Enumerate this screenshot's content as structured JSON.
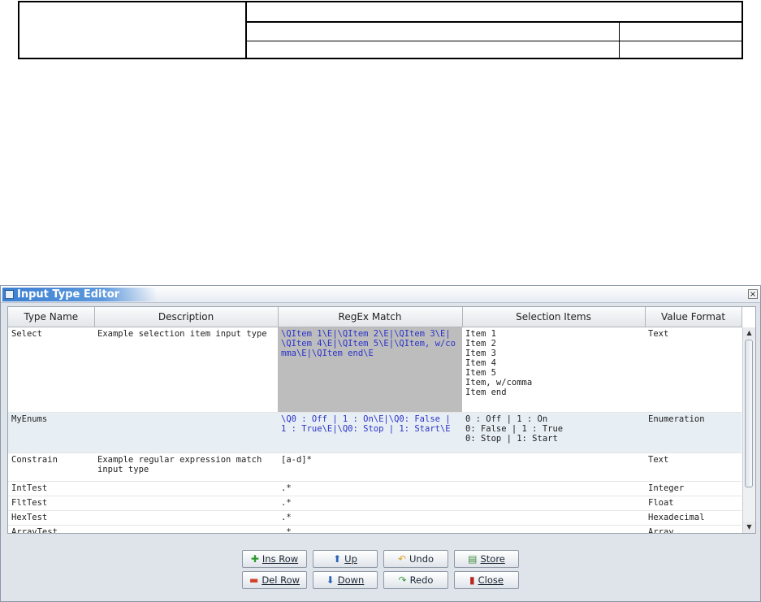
{
  "window": {
    "title": "Input Type Editor",
    "close_glyph": "×"
  },
  "table": {
    "columns": [
      "Type Name",
      "Description",
      "RegEx Match",
      "Selection Items",
      "Value Format"
    ],
    "rows": [
      {
        "name": "Select",
        "description": "Example selection item input type",
        "regex": "\\QItem 1\\E|\\QItem 2\\E|\\QItem 3\\E|\\QItem 4\\E|\\QItem 5\\E|\\QItem, w/comma\\E|\\QItem end\\E",
        "items": "Item 1\nItem 2\nItem 3\nItem 4\nItem 5\nItem, w/comma\nItem end",
        "format": "Text"
      },
      {
        "name": "MyEnums",
        "description": "",
        "regex": "\\Q0 : Off | 1 : On\\E|\\Q0: False | 1 : True\\E|\\Q0: Stop | 1: Start\\E",
        "items": "0 : Off | 1 : On\n0: False | 1 : True\n0: Stop | 1: Start",
        "format": "Enumeration"
      },
      {
        "name": "Constrain",
        "description": "Example regular expression match input type",
        "regex": "[a-d]*",
        "items": "",
        "format": "Text"
      },
      {
        "name": "IntTest",
        "description": "",
        "regex": ".*",
        "items": "",
        "format": "Integer"
      },
      {
        "name": "FltTest",
        "description": "",
        "regex": ".*",
        "items": "",
        "format": "Float"
      },
      {
        "name": "HexTest",
        "description": "",
        "regex": ".*",
        "items": "",
        "format": "Hexadecimal"
      },
      {
        "name": "ArrayTest",
        "description": "",
        "regex": ".*",
        "items": "",
        "format": "Array"
      }
    ]
  },
  "buttons": {
    "ins_row": {
      "label": "Ins Row",
      "icon": "plus-icon"
    },
    "up": {
      "label": "Up",
      "icon": "arrow-up-icon"
    },
    "undo": {
      "label": "Undo",
      "icon": "undo-icon"
    },
    "store": {
      "label": "Store",
      "icon": "store-icon"
    },
    "del_row": {
      "label": "Del Row",
      "icon": "minus-icon"
    },
    "down": {
      "label": "Down",
      "icon": "arrow-down-icon"
    },
    "redo": {
      "label": "Redo",
      "icon": "redo-icon"
    },
    "close": {
      "label": "Close",
      "icon": "close-door-icon"
    }
  },
  "colors": {
    "selected_bg": "#bdbdbd",
    "regex_text": "#2b33c8",
    "hover_row": "#e7eef4",
    "title_blue": "#3b7fd2"
  }
}
